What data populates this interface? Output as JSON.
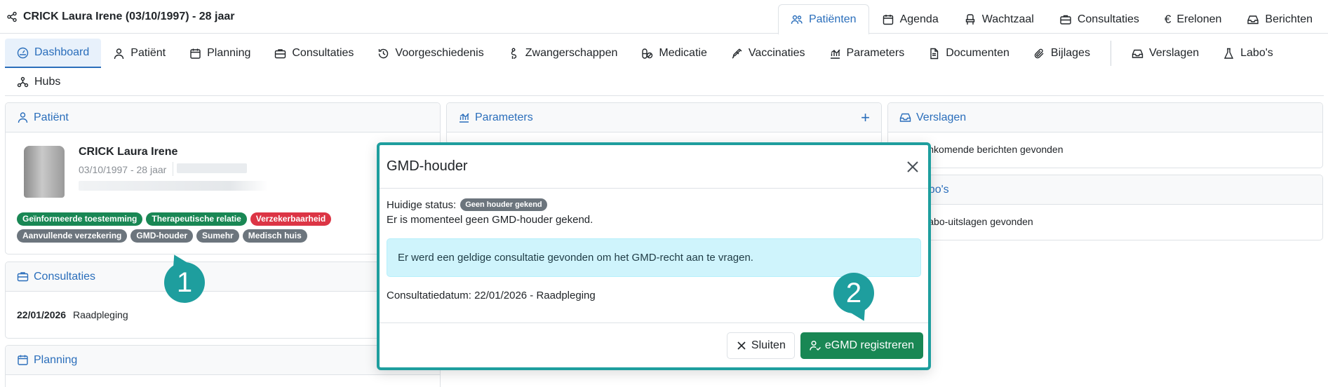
{
  "header": {
    "patient_title": "CRICK Laura Irene (03/10/1997) - 28 jaar",
    "main_tabs": [
      {
        "label": "Patiënten",
        "icon": "users-icon",
        "active": true
      },
      {
        "label": "Agenda",
        "icon": "calendar-icon"
      },
      {
        "label": "Wachtzaal",
        "icon": "chair-icon"
      },
      {
        "label": "Consultaties",
        "icon": "briefcase-icon"
      },
      {
        "label": "Erelonen",
        "icon": "euro-icon"
      },
      {
        "label": "Berichten",
        "icon": "inbox-icon"
      }
    ]
  },
  "subnav": {
    "tabs": [
      {
        "label": "Dashboard",
        "icon": "dashboard-icon",
        "active": true
      },
      {
        "label": "Patiënt",
        "icon": "person-icon"
      },
      {
        "label": "Planning",
        "icon": "calendar-icon"
      },
      {
        "label": "Consultaties",
        "icon": "briefcase-icon"
      },
      {
        "label": "Voorgeschiedenis",
        "icon": "history-icon"
      },
      {
        "label": "Zwangerschappen",
        "icon": "pregnancy-icon"
      },
      {
        "label": "Medicatie",
        "icon": "pills-icon"
      },
      {
        "label": "Vaccinaties",
        "icon": "syringe-icon"
      },
      {
        "label": "Parameters",
        "icon": "chart-icon"
      },
      {
        "label": "Documenten",
        "icon": "document-icon"
      },
      {
        "label": "Bijlages",
        "icon": "paperclip-icon"
      },
      {
        "label": "Verslagen",
        "icon": "inbox-icon"
      },
      {
        "label": "Labo's",
        "icon": "flask-icon"
      }
    ],
    "row2": [
      {
        "label": "Hubs",
        "icon": "hubs-icon"
      }
    ]
  },
  "patient_card": {
    "header": "Patiënt",
    "name": "CRICK Laura Irene",
    "dob": "03/10/1997 - 28 jaar",
    "badges": [
      {
        "label": "Geïnformeerde toestemming",
        "color": "green"
      },
      {
        "label": "Therapeutische relatie",
        "color": "green"
      },
      {
        "label": "Verzekerbaarheid",
        "color": "red"
      },
      {
        "label": "Aanvullende verzekering",
        "color": "grey"
      },
      {
        "label": "GMD-houder",
        "color": "grey"
      },
      {
        "label": "Sumehr",
        "color": "grey"
      },
      {
        "label": "Medisch huis",
        "color": "grey"
      }
    ]
  },
  "consultaties_card": {
    "header": "Consultaties",
    "rows": [
      {
        "date": "22/01/2026",
        "type": "Raadpleging"
      }
    ]
  },
  "planning_card": {
    "header": "Planning"
  },
  "parameters_card": {
    "header": "Parameters",
    "plus": "+"
  },
  "verslagen_card": {
    "header": "Verslagen",
    "empty": "Geen inkomende berichten gevonden"
  },
  "labos_card": {
    "header": "Labo's",
    "empty": "Geen labo-uitslagen gevonden"
  },
  "markers": {
    "one": "1",
    "two": "2"
  },
  "modal": {
    "title": "GMD-houder",
    "status_label": "Huidige status:",
    "status_badge": "Geen houder gekend",
    "status_desc": "Er is momenteel geen GMD-houder gekend.",
    "alert": "Er werd een geldige consultatie gevonden om het GMD-recht aan te vragen.",
    "consult_date": "Consultatiedatum: 22/01/2026 - Raadpleging",
    "close_label": "Sluiten",
    "register_label": "eGMD registreren"
  },
  "colors": {
    "accent": "#2a6ebb",
    "success": "#198754",
    "danger": "#dc3545",
    "secondary": "#6c757d",
    "marker": "#1e9e9e",
    "info_bg": "#cff4fc"
  }
}
